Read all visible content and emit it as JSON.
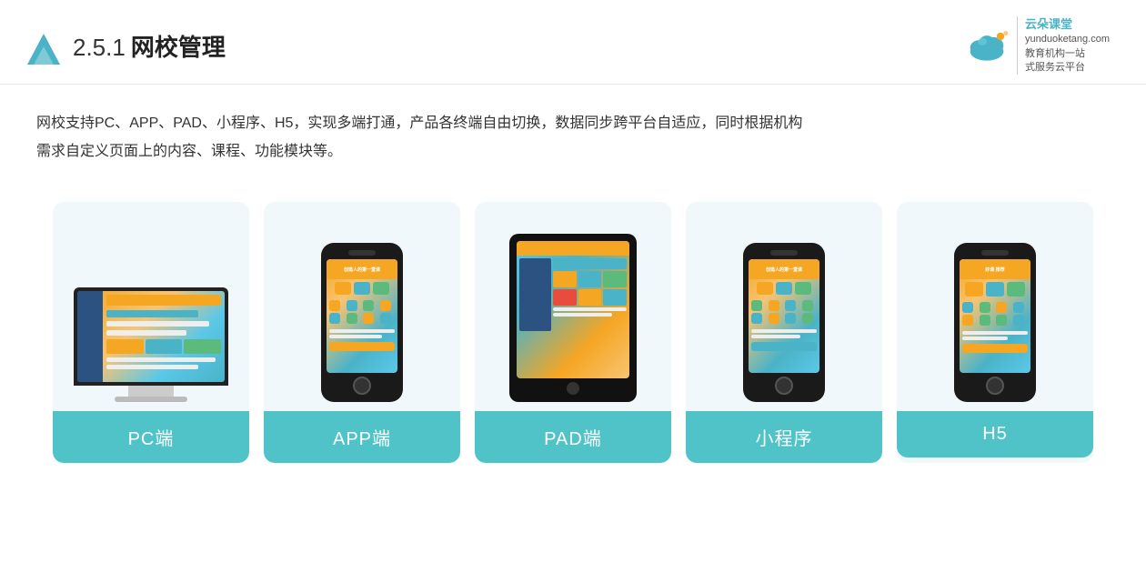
{
  "header": {
    "title_number": "2.5.1",
    "title_text": "网校管理",
    "brand_name": "云朵课堂",
    "brand_domain": "yunduoketang.com",
    "brand_tagline1": "教育机构一站",
    "brand_tagline2": "式服务云平台"
  },
  "description": {
    "line1": "网校支持PC、APP、PAD、小程序、H5，实现多端打通，产品各终端自由切换，数据同步跨平台自适应，同时根据机构",
    "line2": "需求自定义页面上的内容、课程、功能模块等。"
  },
  "cards": [
    {
      "id": "pc",
      "label": "PC端"
    },
    {
      "id": "app",
      "label": "APP端"
    },
    {
      "id": "pad",
      "label": "PAD端"
    },
    {
      "id": "mini",
      "label": "小程序"
    },
    {
      "id": "h5",
      "label": "H5"
    }
  ]
}
